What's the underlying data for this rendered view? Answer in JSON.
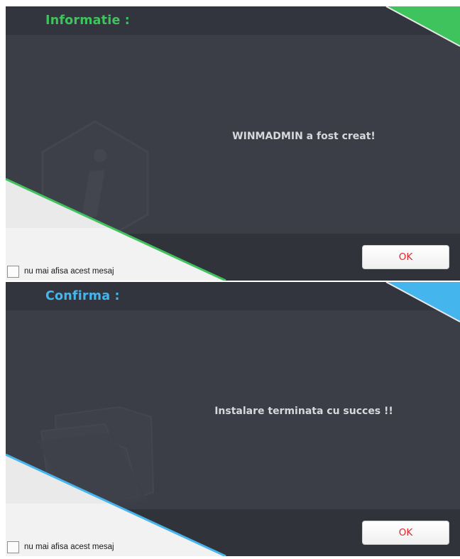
{
  "dialogs": [
    {
      "title": "Informatie :",
      "message": "WINMADMIN a fost creat!",
      "ok_label": "OK",
      "checkbox_label": "nu mai afisa acest mesaj",
      "checkbox_checked": false,
      "accent_color": "#3fc35d",
      "icon": "info-icon"
    },
    {
      "title": "Confirma :",
      "message": "Instalare terminata cu succes !!",
      "ok_label": "OK",
      "checkbox_label": "nu mai afisa acest mesaj",
      "checkbox_checked": false,
      "accent_color": "#45b5ee",
      "icon": "folder-icon"
    }
  ]
}
